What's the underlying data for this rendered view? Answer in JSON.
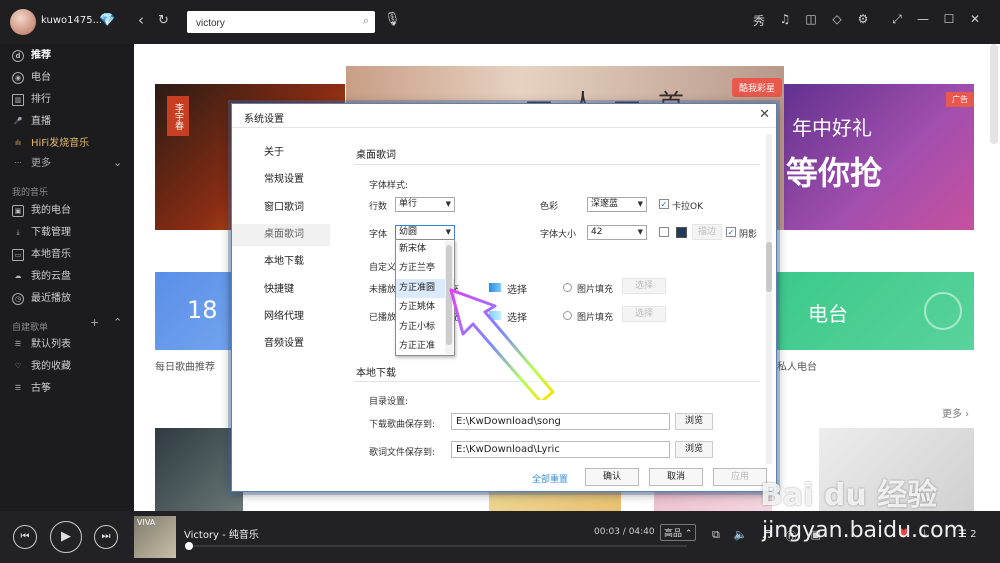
{
  "topbar": {
    "username": "kuwo1475...",
    "search_value": "victory",
    "icons": [
      "skin-icon",
      "headphones-icon",
      "gamepad-icon",
      "shirt-icon",
      "gear-icon",
      "miniplayer-icon",
      "minimize-icon",
      "maximize-icon",
      "close-icon"
    ],
    "icon_glyphs": [
      "秀",
      "♫",
      "◫",
      "◇",
      "⚙",
      "⤢",
      "—",
      "☐",
      "✕"
    ]
  },
  "sidebar": {
    "main_items": [
      {
        "label": "推荐",
        "icon": "disc-icon"
      },
      {
        "label": "电台",
        "icon": "radio-icon"
      },
      {
        "label": "排行",
        "icon": "chart-icon"
      },
      {
        "label": "直播",
        "icon": "mic-icon"
      },
      {
        "label": "HiFi发烧音乐",
        "icon": "hifi-icon"
      },
      {
        "label": "更多",
        "icon": "more-icon"
      }
    ],
    "my_music_heading": "我的音乐",
    "my_music_items": [
      {
        "label": "我的电台",
        "icon": "my-radio-icon"
      },
      {
        "label": "下载管理",
        "icon": "download-icon"
      },
      {
        "label": "本地音乐",
        "icon": "computer-icon"
      },
      {
        "label": "我的云盘",
        "icon": "cloud-icon"
      },
      {
        "label": "最近播放",
        "icon": "clock-icon"
      }
    ],
    "playlist_heading": "自建歌单",
    "playlist_items": [
      {
        "label": "默认列表",
        "icon": "list-icon"
      },
      {
        "label": "我的收藏",
        "icon": "heart-icon"
      },
      {
        "label": "古筝",
        "icon": "list-icon"
      }
    ]
  },
  "main": {
    "banner_center_tag": "酷我彩星",
    "banner_center_text": "一人一首",
    "banner_left_poster": "李宇春",
    "banner_right_ad": "广告",
    "banner_right_line1": "年中好礼",
    "banner_right_line2": "等你抢",
    "card_daily_number": "18",
    "card_daily_caption": "每日歌曲推荐",
    "card_radio_title": "电台",
    "card_radio_caption": "私人电台",
    "more_label": "更多 ›"
  },
  "dialog": {
    "title": "系统设置",
    "nav": [
      "关于",
      "常规设置",
      "窗口歌词",
      "桌面歌词",
      "本地下载",
      "快捷键",
      "网络代理",
      "音频设置"
    ],
    "selected_nav": "桌面歌词",
    "desktop_lyrics": {
      "section_title": "桌面歌词",
      "font_style_label": "字体样式:",
      "lines_label": "行数",
      "lines_value": "单行",
      "color_label": "色彩",
      "color_value": "深邃蓝",
      "karaoke_label": "卡拉OK",
      "font_label": "字体",
      "font_value": "幼圆",
      "font_size_label": "字体大小",
      "font_size_value": "42",
      "stroke_label": "描边",
      "shadow_label": "阴影",
      "custom_label": "自定义",
      "unplayed_label": "未播放",
      "played_label": "已播放",
      "gradient_fill_label": "渐变填充",
      "select_label": "选择",
      "image_fill_label": "图片填充"
    },
    "font_options": [
      "新宋体",
      "方正兰亭",
      "方正准圆",
      "方正姚体",
      "方正小标",
      "方正正准"
    ],
    "highlighted_option": "方正准圆",
    "local_download": {
      "section_title": "本地下载",
      "dir_settings_label": "目录设置:",
      "song_dir_label": "下载歌曲保存到:",
      "song_dir_value": "E:\\KwDownload\\song",
      "lyric_dir_label": "歌词文件保存到:",
      "lyric_dir_value": "E:\\KwDownload\\Lyric",
      "browse_label": "浏览"
    },
    "footer": {
      "reset_label": "全部重置",
      "ok_label": "确认",
      "cancel_label": "取消",
      "apply_label": "应用"
    }
  },
  "player": {
    "cover_text": "VIVA",
    "track_title": "Victory - 纯音乐",
    "time": "00:03 / 04:40",
    "quality": "高品 ⌃",
    "queue_count": "2",
    "icons": [
      "lyrics-icon",
      "volume-icon",
      "sound-effect-icon",
      "hifi-icon",
      "mv-icon",
      "heart-icon",
      "download-icon",
      "queue-icon"
    ]
  },
  "watermark": {
    "line1": "Bai du 经验",
    "line2": "jingyan.baidu.com"
  }
}
